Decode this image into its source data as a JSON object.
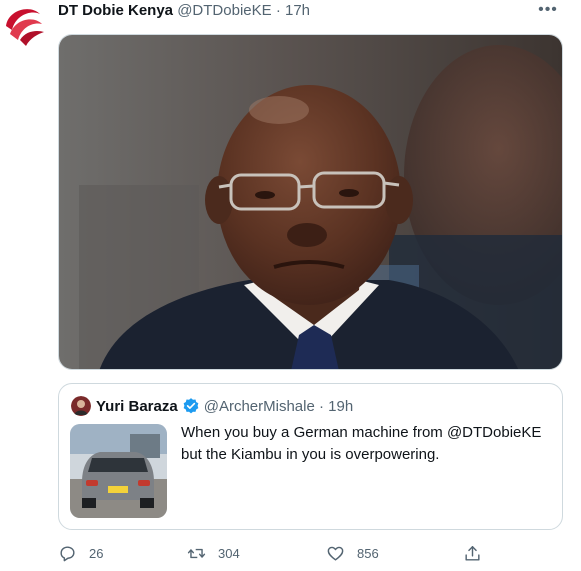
{
  "tweet": {
    "author_name": "DT Dobie Kenya",
    "author_handle": "@DTDobieKE",
    "separator": "·",
    "time": "17h",
    "more_icon": "more-horizontal-icon",
    "more_label": "•••"
  },
  "quoted_tweet": {
    "author_name": "Yuri Baraza",
    "verified_icon": "verified-badge-icon",
    "author_handle": "@ArcherMishale",
    "separator": "·",
    "time": "19h",
    "text": "When you buy a German machine from @DTDobieKE but the Kiambu in you is overpowering."
  },
  "actions": {
    "reply": {
      "icon": "reply-icon",
      "count": "26"
    },
    "retweet": {
      "icon": "retweet-icon",
      "count": "304"
    },
    "like": {
      "icon": "heart-icon",
      "count": "856"
    },
    "share": {
      "icon": "share-icon"
    }
  },
  "colors": {
    "text": "#0f1419",
    "muted": "#536471",
    "border": "#cfd9de",
    "brand_red": "#d7263d",
    "verified_blue": "#1d9bf0"
  }
}
